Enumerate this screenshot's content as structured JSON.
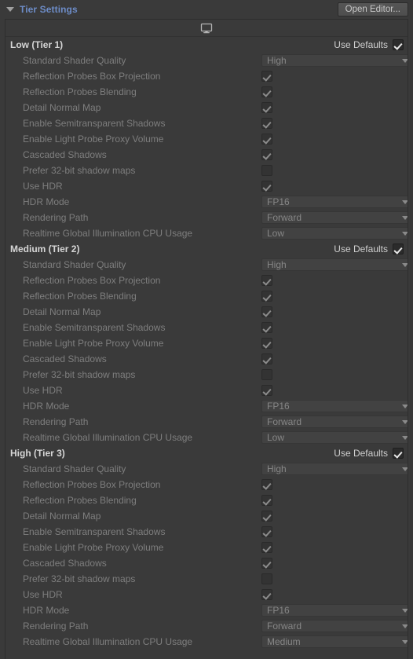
{
  "header": {
    "title": "Tier Settings",
    "foldout_icon": "triangle-down-icon",
    "open_editor_label": "Open Editor...",
    "title_color": "#6d8cc7"
  },
  "platform_strip": {
    "icon": "monitor-icon",
    "tooltip": "Standalone"
  },
  "labels": {
    "use_defaults": "Use Defaults"
  },
  "tiers": [
    {
      "name": "Low (Tier 1)",
      "use_defaults": true,
      "properties": [
        {
          "label": "Standard Shader Quality",
          "type": "dropdown",
          "value": "High"
        },
        {
          "label": "Reflection Probes Box Projection",
          "type": "checkbox",
          "checked": true
        },
        {
          "label": "Reflection Probes Blending",
          "type": "checkbox",
          "checked": true
        },
        {
          "label": "Detail Normal Map",
          "type": "checkbox",
          "checked": true
        },
        {
          "label": "Enable Semitransparent Shadows",
          "type": "checkbox",
          "checked": true
        },
        {
          "label": "Enable Light Probe Proxy Volume",
          "type": "checkbox",
          "checked": true
        },
        {
          "label": "Cascaded Shadows",
          "type": "checkbox",
          "checked": true
        },
        {
          "label": "Prefer 32-bit shadow maps",
          "type": "checkbox",
          "checked": false
        },
        {
          "label": "Use HDR",
          "type": "checkbox",
          "checked": true
        },
        {
          "label": "HDR Mode",
          "type": "dropdown",
          "value": "FP16"
        },
        {
          "label": "Rendering Path",
          "type": "dropdown",
          "value": "Forward"
        },
        {
          "label": "Realtime Global Illumination CPU Usage",
          "type": "dropdown",
          "value": "Low"
        }
      ]
    },
    {
      "name": "Medium (Tier 2)",
      "use_defaults": true,
      "properties": [
        {
          "label": "Standard Shader Quality",
          "type": "dropdown",
          "value": "High"
        },
        {
          "label": "Reflection Probes Box Projection",
          "type": "checkbox",
          "checked": true
        },
        {
          "label": "Reflection Probes Blending",
          "type": "checkbox",
          "checked": true
        },
        {
          "label": "Detail Normal Map",
          "type": "checkbox",
          "checked": true
        },
        {
          "label": "Enable Semitransparent Shadows",
          "type": "checkbox",
          "checked": true
        },
        {
          "label": "Enable Light Probe Proxy Volume",
          "type": "checkbox",
          "checked": true
        },
        {
          "label": "Cascaded Shadows",
          "type": "checkbox",
          "checked": true
        },
        {
          "label": "Prefer 32-bit shadow maps",
          "type": "checkbox",
          "checked": false
        },
        {
          "label": "Use HDR",
          "type": "checkbox",
          "checked": true
        },
        {
          "label": "HDR Mode",
          "type": "dropdown",
          "value": "FP16"
        },
        {
          "label": "Rendering Path",
          "type": "dropdown",
          "value": "Forward"
        },
        {
          "label": "Realtime Global Illumination CPU Usage",
          "type": "dropdown",
          "value": "Low"
        }
      ]
    },
    {
      "name": "High (Tier 3)",
      "use_defaults": true,
      "properties": [
        {
          "label": "Standard Shader Quality",
          "type": "dropdown",
          "value": "High"
        },
        {
          "label": "Reflection Probes Box Projection",
          "type": "checkbox",
          "checked": true
        },
        {
          "label": "Reflection Probes Blending",
          "type": "checkbox",
          "checked": true
        },
        {
          "label": "Detail Normal Map",
          "type": "checkbox",
          "checked": true
        },
        {
          "label": "Enable Semitransparent Shadows",
          "type": "checkbox",
          "checked": true
        },
        {
          "label": "Enable Light Probe Proxy Volume",
          "type": "checkbox",
          "checked": true
        },
        {
          "label": "Cascaded Shadows",
          "type": "checkbox",
          "checked": true
        },
        {
          "label": "Prefer 32-bit shadow maps",
          "type": "checkbox",
          "checked": false
        },
        {
          "label": "Use HDR",
          "type": "checkbox",
          "checked": true
        },
        {
          "label": "HDR Mode",
          "type": "dropdown",
          "value": "FP16"
        },
        {
          "label": "Rendering Path",
          "type": "dropdown",
          "value": "Forward"
        },
        {
          "label": "Realtime Global Illumination CPU Usage",
          "type": "dropdown",
          "value": "Medium"
        }
      ]
    }
  ]
}
